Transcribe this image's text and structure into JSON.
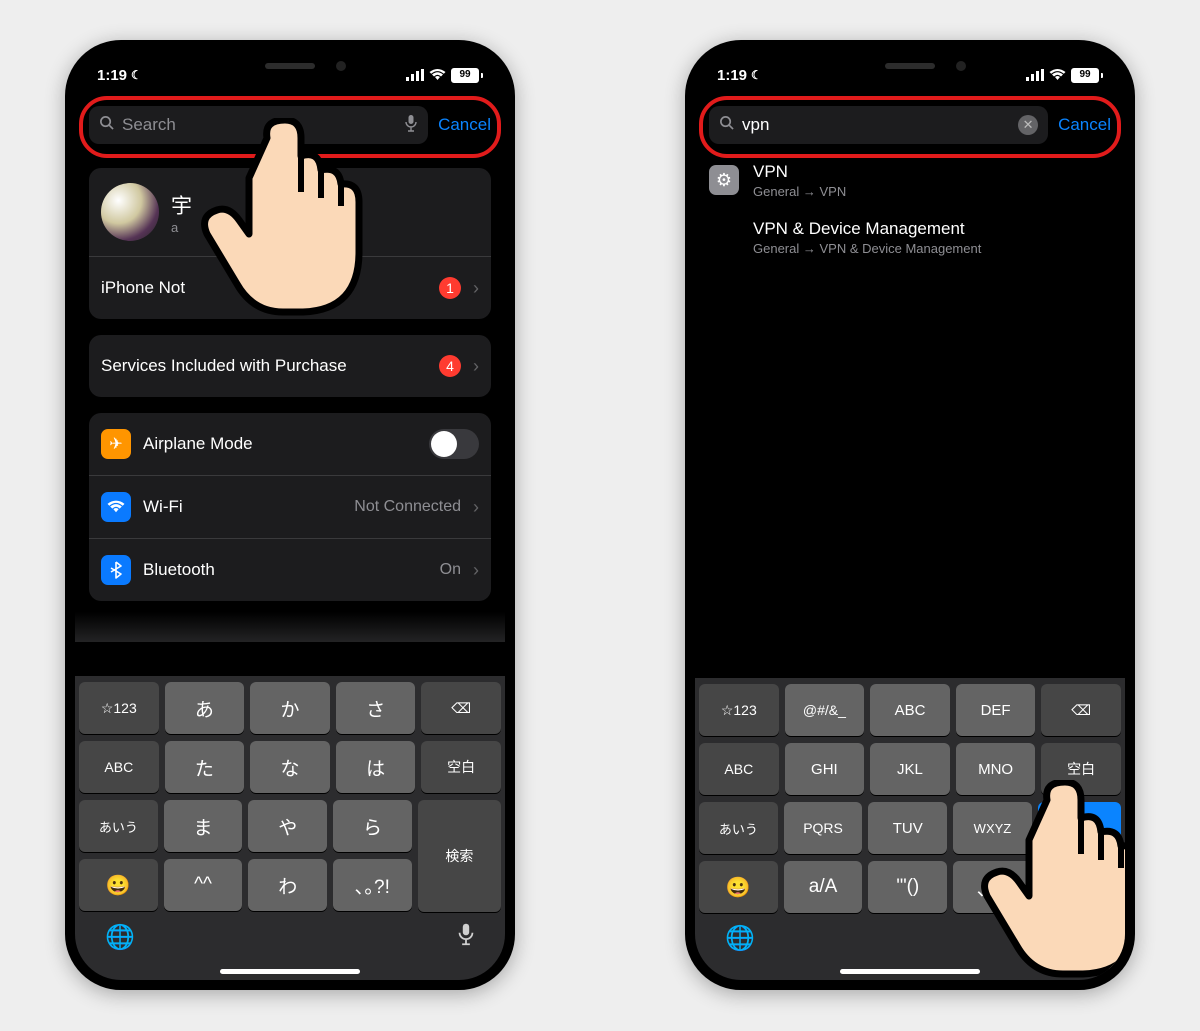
{
  "status": {
    "time": "1:19",
    "battery": "99"
  },
  "left": {
    "search_placeholder": "Search",
    "search_value": "",
    "cancel": "Cancel",
    "profile_name": "宇",
    "profile_sub": "a",
    "rows": {
      "iphone_not": "iPhone Not",
      "iphone_not_badge": "1",
      "services": "Services Included with Purchase",
      "services_badge": "4",
      "airplane": "Airplane Mode",
      "wifi": "Wi-Fi",
      "wifi_status": "Not Connected",
      "bluetooth": "Bluetooth",
      "bluetooth_status": "On"
    },
    "keyboard": {
      "r1": [
        "☆123",
        "あ",
        "か",
        "さ",
        "⌫"
      ],
      "r2": [
        "ABC",
        "た",
        "な",
        "は",
        "空白"
      ],
      "r3": [
        "あいう",
        "ま",
        "や",
        "ら",
        "検索"
      ],
      "r4": [
        "😀",
        "^^",
        "わ",
        "､｡?!",
        ""
      ]
    }
  },
  "right": {
    "search_value": "vpn",
    "cancel": "Cancel",
    "results": [
      {
        "title": "VPN",
        "path": "General → VPN"
      },
      {
        "title": "VPN & Device Management",
        "path": "General → VPN & Device Management"
      }
    ],
    "keyboard": {
      "r1": [
        "☆123",
        "@#/&_",
        "ABC",
        "DEF",
        "⌫"
      ],
      "r2": [
        "ABC",
        "GHI",
        "JKL",
        "MNO",
        "空白"
      ],
      "r3": [
        "あいう",
        "PQRS",
        "TUV",
        "WXYZ",
        ""
      ],
      "r4": [
        "😀",
        "a/A",
        "'\"()",
        "､,?!",
        ""
      ]
    }
  }
}
